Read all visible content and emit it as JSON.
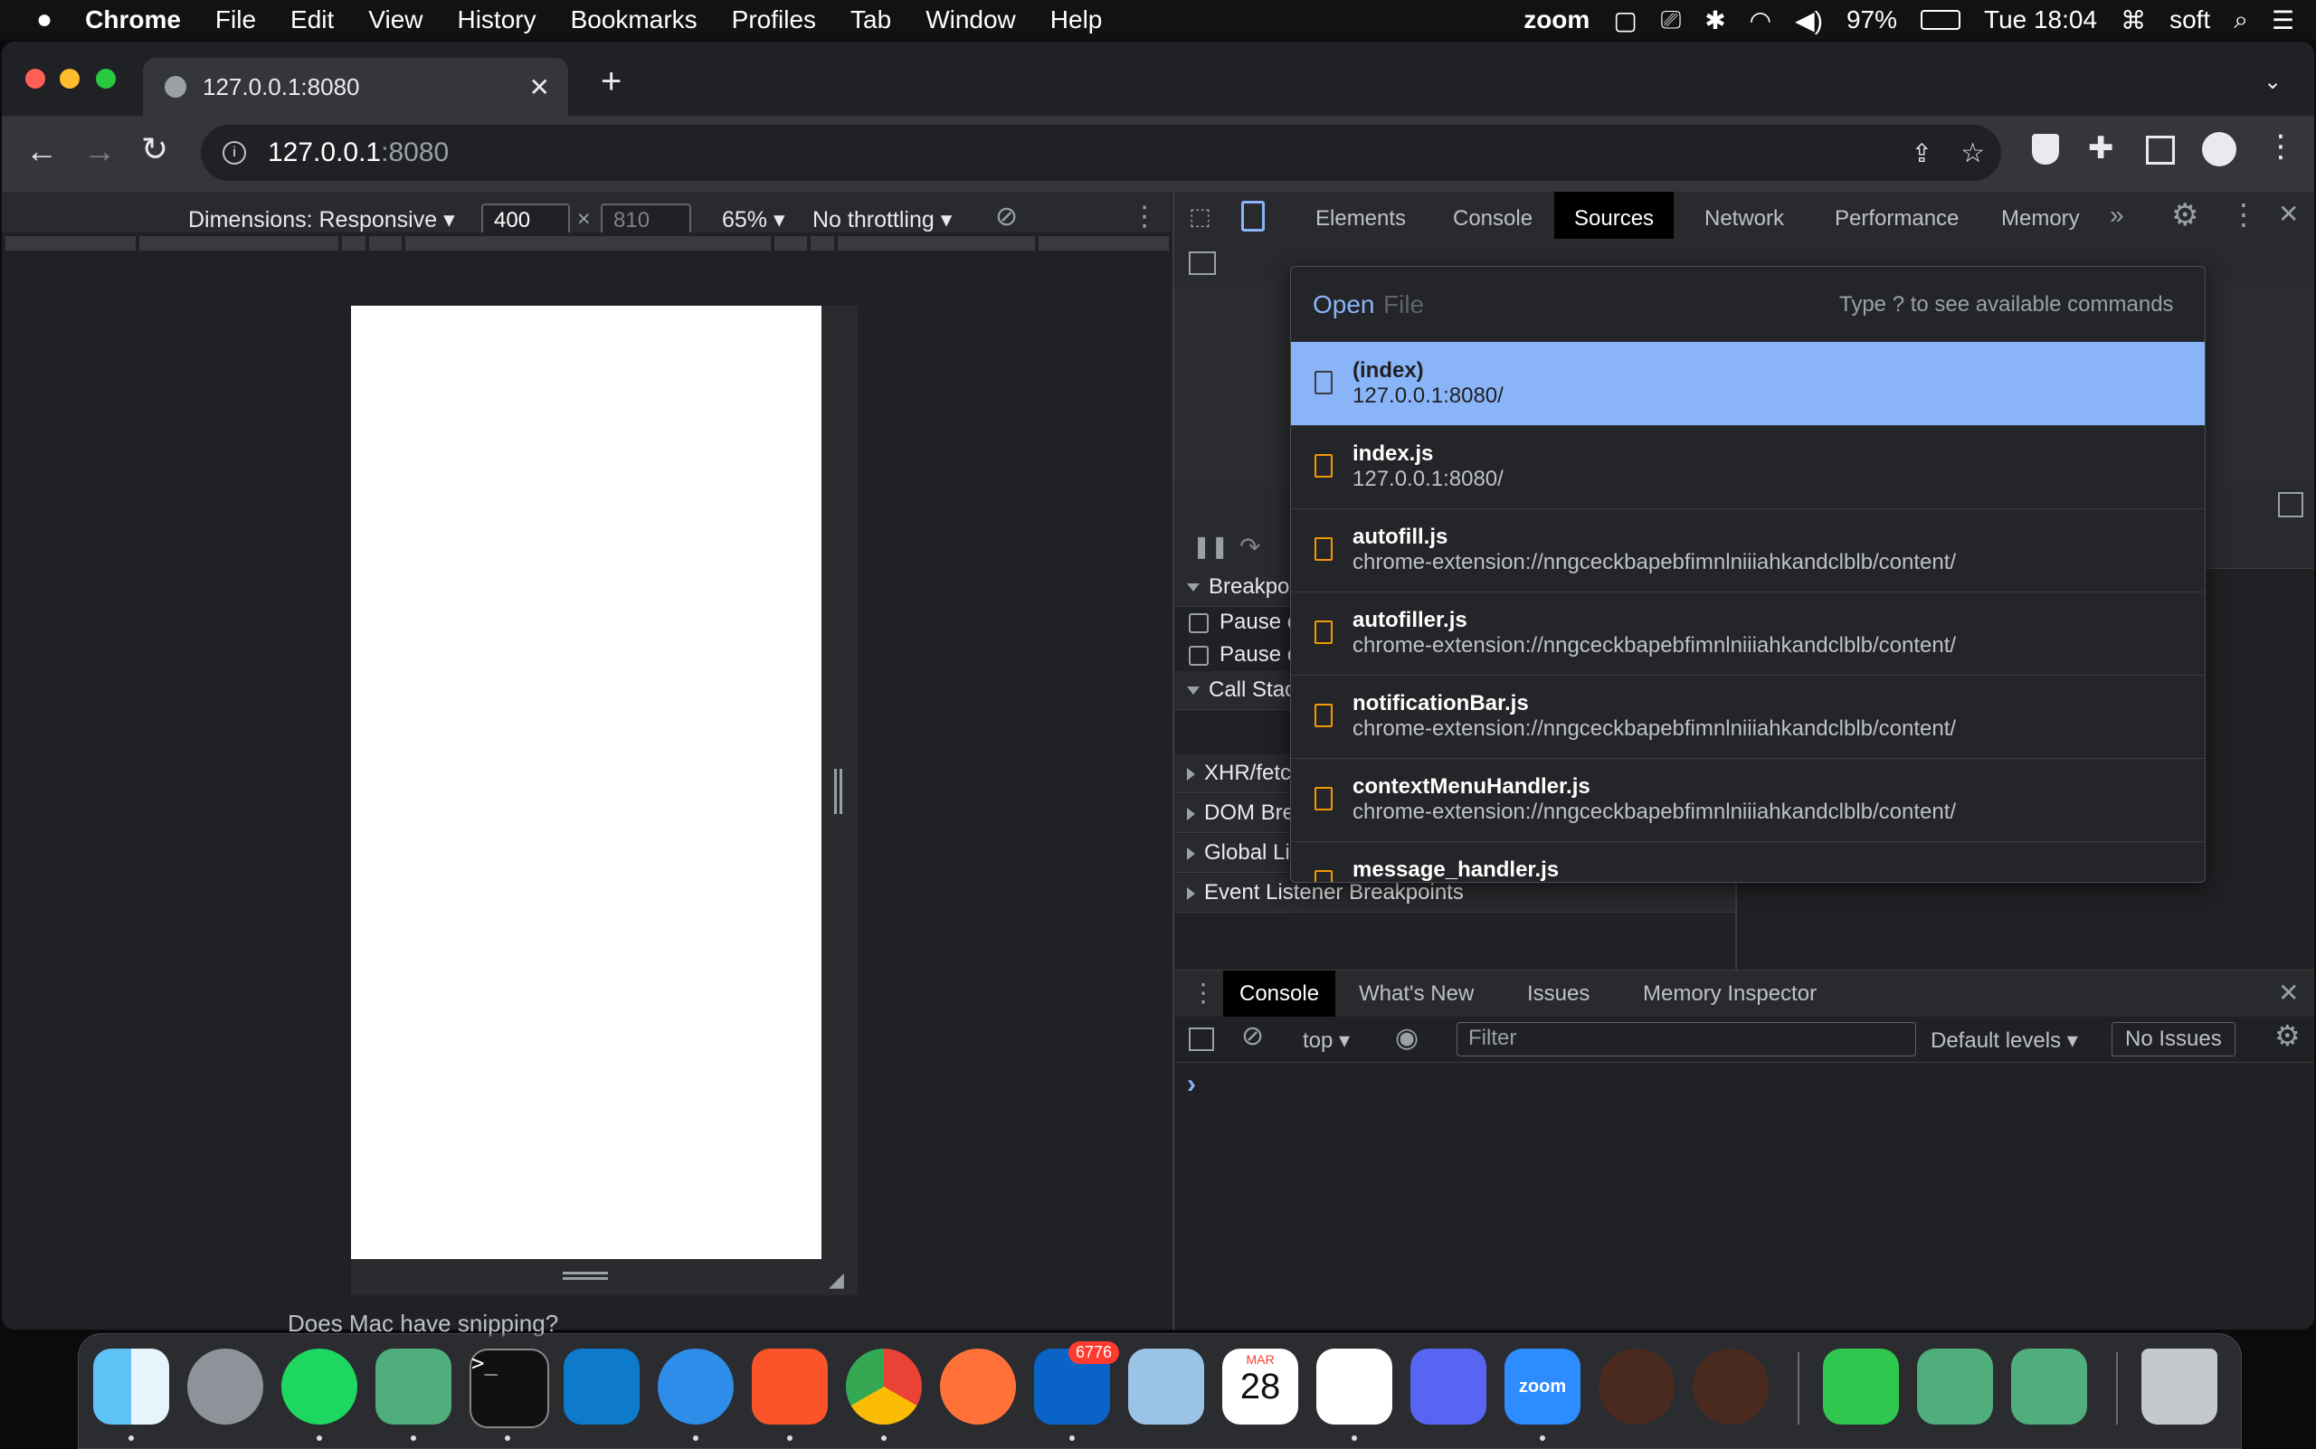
{
  "menubar": {
    "app": "Chrome",
    "items": [
      "File",
      "Edit",
      "View",
      "History",
      "Bookmarks",
      "Profiles",
      "Tab",
      "Window",
      "Help"
    ],
    "zoom": "zoom",
    "battery": "97%",
    "clock": "Tue 18:04",
    "user": "soft"
  },
  "tab": {
    "title": "127.0.0.1:8080"
  },
  "omnibox": {
    "host": "127.0.0.1",
    "port": ":8080"
  },
  "device_toolbar": {
    "dimensions": "Dimensions: Responsive",
    "width": "400",
    "times": "×",
    "height": "810",
    "zoom": "65%",
    "throttle": "No throttling"
  },
  "devtools": {
    "tabs": [
      "Elements",
      "Console",
      "Sources",
      "Network",
      "Performance",
      "Memory"
    ],
    "active_tab": "Sources",
    "sections": {
      "breakpoints": "Breakpoi",
      "pause1": "Pause o",
      "pause2": "Pause o",
      "callstack": "Call Stac",
      "xhr": "XHR/fetc",
      "dom": "DOM Bre",
      "global": "Global Listeners",
      "event": "Event Listener Breakpoints"
    }
  },
  "quick_open": {
    "prefix": "Open",
    "placeholder": "File",
    "hint": "Type ? to see available commands",
    "items": [
      {
        "name": "(index)",
        "path": "127.0.0.1:8080/"
      },
      {
        "name": "index.js",
        "path": "127.0.0.1:8080/"
      },
      {
        "name": "autofill.js",
        "path": "chrome-extension://nngceckbapebfimnlniiiahkandclblb/content/"
      },
      {
        "name": "autofiller.js",
        "path": "chrome-extension://nngceckbapebfimnlniiiahkandclblb/content/"
      },
      {
        "name": "notificationBar.js",
        "path": "chrome-extension://nngceckbapebfimnlniiiahkandclblb/content/"
      },
      {
        "name": "contextMenuHandler.js",
        "path": "chrome-extension://nngceckbapebfimnlniiiahkandclblb/content/"
      },
      {
        "name": "message_handler.js",
        "path": ""
      }
    ]
  },
  "drawer": {
    "tabs": [
      "Console",
      "What's New",
      "Issues",
      "Memory Inspector"
    ],
    "context": "top",
    "filter_placeholder": "Filter",
    "levels": "Default levels",
    "issues": "No Issues",
    "prompt": "›"
  },
  "hint_text": "Does Mac have snipping?",
  "dock": {
    "outlook_badge": "6776",
    "calendar_month": "MAR",
    "calendar_day": "28",
    "zoom_label": "zoom"
  }
}
